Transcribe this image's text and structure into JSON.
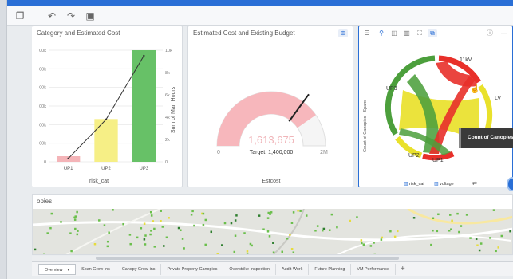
{
  "toolbar": {
    "items": [
      {
        "name": "pages-icon",
        "glyph": "❐"
      },
      {
        "name": "undo-icon",
        "glyph": "↶"
      },
      {
        "name": "redo-icon",
        "glyph": "↷"
      },
      {
        "name": "save-icon",
        "glyph": "▣"
      }
    ]
  },
  "card1": {
    "title": "Category and Estimated Cost",
    "xlabel": "risk_cat",
    "y2label": "Sum of Man Hours"
  },
  "card2": {
    "title": "Estimated Cost and Existing Budget",
    "value": "1,613,675",
    "target": "Target: 1,400,000",
    "min": "0",
    "max": "2M",
    "label": "Estcost"
  },
  "card3": {
    "ylabel": "Count of Canopies - Spans",
    "labels": {
      "kv": "11kV",
      "lv": "LV",
      "up3": "UP3",
      "up2": "UP2",
      "up1": "UP1"
    },
    "chip1": "risk_cat",
    "chip2": "voltage"
  },
  "tooltip": {
    "text": "Count of Canopies"
  },
  "map": {
    "title": "opies"
  },
  "tabs": [
    {
      "label": "Overview",
      "active": true
    },
    {
      "label": "Span Grow-ins",
      "active": false
    },
    {
      "label": "Canopy Grow-ins",
      "active": false
    },
    {
      "label": "Private Property Canopies",
      "active": false
    },
    {
      "label": "Overstrike Inspection",
      "active": false
    },
    {
      "label": "Audit Work",
      "active": false
    },
    {
      "label": "Future Planning",
      "active": false
    },
    {
      "label": "VM Performance",
      "active": false
    }
  ],
  "tab_add": "+",
  "colors": {
    "accent": "#2a6fd6",
    "bar_pink": "#f4b4b8",
    "bar_yellow": "#f6ef86",
    "bar_green": "#67c167",
    "gauge_fill": "#f7b7bc",
    "chord_red": "#e8302a",
    "chord_yellow": "#e9e12b",
    "chord_green": "#4c9f3c"
  },
  "chart_data": [
    {
      "type": "bar",
      "title": "Category and Estimated Cost",
      "xlabel": "risk_cat",
      "ylabel": "",
      "y2label": "Sum of Man Hours",
      "categories": [
        "UP1",
        "UP2",
        "UP3"
      ],
      "series": [
        {
          "name": "",
          "values": [
            30000,
            230000,
            600000
          ]
        },
        {
          "name": "Sum of Man Hours",
          "values": [
            300,
            3800,
            9500
          ]
        }
      ],
      "yticks": [
        "0",
        "00k",
        "00k",
        "00k",
        "00k",
        "00k",
        "00k"
      ],
      "ylim": [
        0,
        600000
      ],
      "y2ticks": [
        "0",
        "2k",
        "4k",
        "6k",
        "8k",
        "10k"
      ],
      "y2lim": [
        0,
        10000
      ],
      "grid": true
    },
    {
      "type": "gauge",
      "title": "Estimated Cost and Existing Budget",
      "value": 1613675,
      "target": 1400000,
      "min": 0,
      "max": 2000000
    }
  ]
}
